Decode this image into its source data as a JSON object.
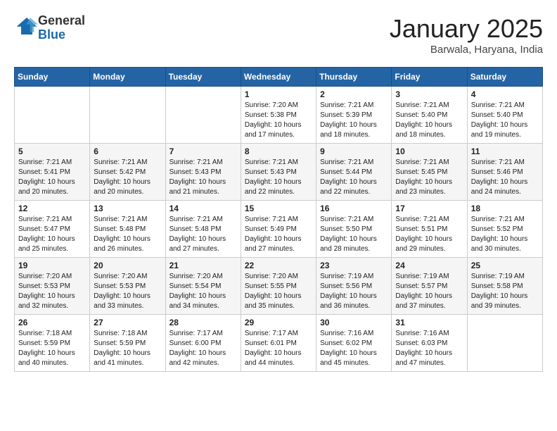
{
  "logo": {
    "general": "General",
    "blue": "Blue"
  },
  "header": {
    "month": "January 2025",
    "location": "Barwala, Haryana, India"
  },
  "weekdays": [
    "Sunday",
    "Monday",
    "Tuesday",
    "Wednesday",
    "Thursday",
    "Friday",
    "Saturday"
  ],
  "weeks": [
    [
      {
        "day": "",
        "info": ""
      },
      {
        "day": "",
        "info": ""
      },
      {
        "day": "",
        "info": ""
      },
      {
        "day": "1",
        "info": "Sunrise: 7:20 AM\nSunset: 5:38 PM\nDaylight: 10 hours and 17 minutes."
      },
      {
        "day": "2",
        "info": "Sunrise: 7:21 AM\nSunset: 5:39 PM\nDaylight: 10 hours and 18 minutes."
      },
      {
        "day": "3",
        "info": "Sunrise: 7:21 AM\nSunset: 5:40 PM\nDaylight: 10 hours and 18 minutes."
      },
      {
        "day": "4",
        "info": "Sunrise: 7:21 AM\nSunset: 5:40 PM\nDaylight: 10 hours and 19 minutes."
      }
    ],
    [
      {
        "day": "5",
        "info": "Sunrise: 7:21 AM\nSunset: 5:41 PM\nDaylight: 10 hours and 20 minutes."
      },
      {
        "day": "6",
        "info": "Sunrise: 7:21 AM\nSunset: 5:42 PM\nDaylight: 10 hours and 20 minutes."
      },
      {
        "day": "7",
        "info": "Sunrise: 7:21 AM\nSunset: 5:43 PM\nDaylight: 10 hours and 21 minutes."
      },
      {
        "day": "8",
        "info": "Sunrise: 7:21 AM\nSunset: 5:43 PM\nDaylight: 10 hours and 22 minutes."
      },
      {
        "day": "9",
        "info": "Sunrise: 7:21 AM\nSunset: 5:44 PM\nDaylight: 10 hours and 22 minutes."
      },
      {
        "day": "10",
        "info": "Sunrise: 7:21 AM\nSunset: 5:45 PM\nDaylight: 10 hours and 23 minutes."
      },
      {
        "day": "11",
        "info": "Sunrise: 7:21 AM\nSunset: 5:46 PM\nDaylight: 10 hours and 24 minutes."
      }
    ],
    [
      {
        "day": "12",
        "info": "Sunrise: 7:21 AM\nSunset: 5:47 PM\nDaylight: 10 hours and 25 minutes."
      },
      {
        "day": "13",
        "info": "Sunrise: 7:21 AM\nSunset: 5:48 PM\nDaylight: 10 hours and 26 minutes."
      },
      {
        "day": "14",
        "info": "Sunrise: 7:21 AM\nSunset: 5:48 PM\nDaylight: 10 hours and 27 minutes."
      },
      {
        "day": "15",
        "info": "Sunrise: 7:21 AM\nSunset: 5:49 PM\nDaylight: 10 hours and 27 minutes."
      },
      {
        "day": "16",
        "info": "Sunrise: 7:21 AM\nSunset: 5:50 PM\nDaylight: 10 hours and 28 minutes."
      },
      {
        "day": "17",
        "info": "Sunrise: 7:21 AM\nSunset: 5:51 PM\nDaylight: 10 hours and 29 minutes."
      },
      {
        "day": "18",
        "info": "Sunrise: 7:21 AM\nSunset: 5:52 PM\nDaylight: 10 hours and 30 minutes."
      }
    ],
    [
      {
        "day": "19",
        "info": "Sunrise: 7:20 AM\nSunset: 5:53 PM\nDaylight: 10 hours and 32 minutes."
      },
      {
        "day": "20",
        "info": "Sunrise: 7:20 AM\nSunset: 5:53 PM\nDaylight: 10 hours and 33 minutes."
      },
      {
        "day": "21",
        "info": "Sunrise: 7:20 AM\nSunset: 5:54 PM\nDaylight: 10 hours and 34 minutes."
      },
      {
        "day": "22",
        "info": "Sunrise: 7:20 AM\nSunset: 5:55 PM\nDaylight: 10 hours and 35 minutes."
      },
      {
        "day": "23",
        "info": "Sunrise: 7:19 AM\nSunset: 5:56 PM\nDaylight: 10 hours and 36 minutes."
      },
      {
        "day": "24",
        "info": "Sunrise: 7:19 AM\nSunset: 5:57 PM\nDaylight: 10 hours and 37 minutes."
      },
      {
        "day": "25",
        "info": "Sunrise: 7:19 AM\nSunset: 5:58 PM\nDaylight: 10 hours and 39 minutes."
      }
    ],
    [
      {
        "day": "26",
        "info": "Sunrise: 7:18 AM\nSunset: 5:59 PM\nDaylight: 10 hours and 40 minutes."
      },
      {
        "day": "27",
        "info": "Sunrise: 7:18 AM\nSunset: 5:59 PM\nDaylight: 10 hours and 41 minutes."
      },
      {
        "day": "28",
        "info": "Sunrise: 7:17 AM\nSunset: 6:00 PM\nDaylight: 10 hours and 42 minutes."
      },
      {
        "day": "29",
        "info": "Sunrise: 7:17 AM\nSunset: 6:01 PM\nDaylight: 10 hours and 44 minutes."
      },
      {
        "day": "30",
        "info": "Sunrise: 7:16 AM\nSunset: 6:02 PM\nDaylight: 10 hours and 45 minutes."
      },
      {
        "day": "31",
        "info": "Sunrise: 7:16 AM\nSunset: 6:03 PM\nDaylight: 10 hours and 47 minutes."
      },
      {
        "day": "",
        "info": ""
      }
    ]
  ]
}
